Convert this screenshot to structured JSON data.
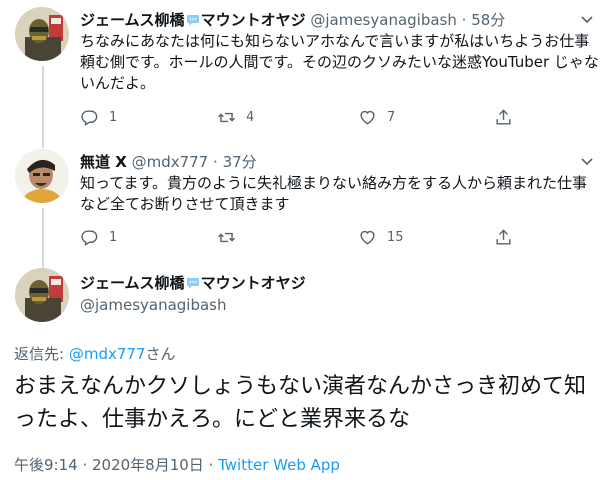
{
  "tweets": [
    {
      "name": "ジェームス柳橋",
      "name_suffix": "マウントオヤジ",
      "handle": "@jamesyanagibash",
      "dot": "·",
      "time": "58分",
      "text": "ちなみにあなたは何にも知らないアホなんで言いますが私はいちようお仕事頼む側です。ホールの人間です。その辺のクソみたいな迷惑YouTuber じゃないんだよ。",
      "replies": "1",
      "retweets": "4",
      "likes": "7"
    },
    {
      "name": "無道 X",
      "handle": "@mdx777",
      "dot": "·",
      "time": "37分",
      "text": "知ってます。貴方のように失礼極まりない絡み方をする人から頼まれた仕事など全てお断りさせて頂きます",
      "replies": "1",
      "retweets": "",
      "likes": "15"
    }
  ],
  "main_tweet": {
    "name": "ジェームス柳橋",
    "name_suffix": "マウントオヤジ",
    "handle": "@jamesyanagibash",
    "reply_label": "返信先: ",
    "reply_mention": "@mdx777",
    "reply_suffix": "さん",
    "text": "おまえなんかクソしょうもない演者なんかさっき初めて知ったよ、仕事かえろ。にどと業界来るな",
    "timestamp": "午後9:14 · 2020年8月10日 · ",
    "app": "Twitter Web App"
  },
  "icons": {
    "reply": "reply-icon",
    "retweet": "retweet-icon",
    "like": "heart-icon",
    "share": "share-icon",
    "more": "chevron-down-icon",
    "speech": "speech-bubble-icon"
  },
  "colors": {
    "text": "#0f1419",
    "secondary": "#536471",
    "link": "#1d9bf0"
  }
}
